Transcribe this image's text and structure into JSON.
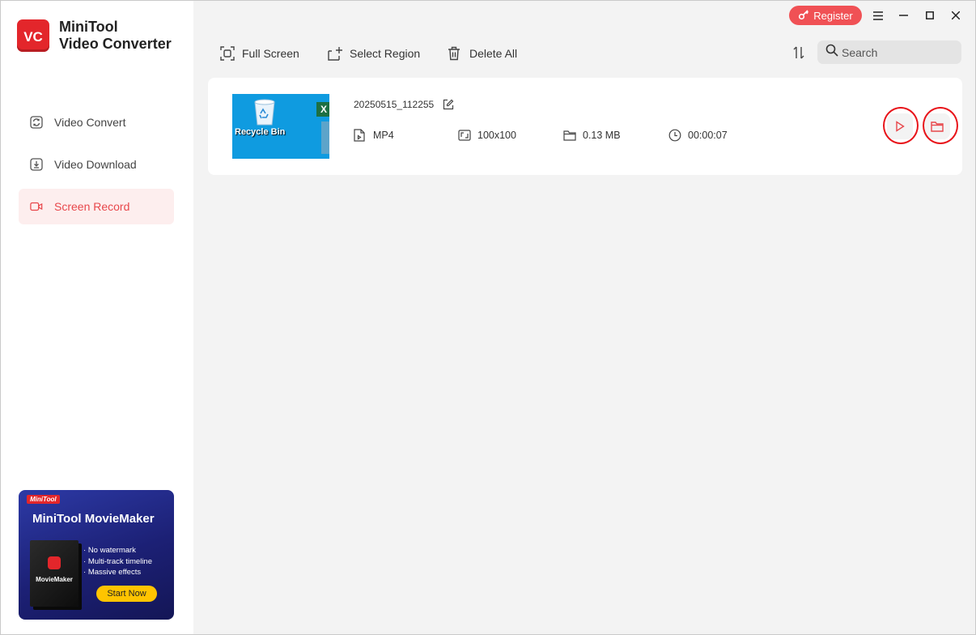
{
  "app": {
    "name_line1": "MiniTool",
    "name_line2": "Video Converter",
    "logo_text": "VC",
    "accent_color": "#e8474b"
  },
  "sidebar": {
    "items": [
      {
        "label": "Video Convert",
        "icon": "convert-icon",
        "active": false
      },
      {
        "label": "Video Download",
        "icon": "download-icon",
        "active": false
      },
      {
        "label": "Screen Record",
        "icon": "video-camera-icon",
        "active": true
      }
    ]
  },
  "promo": {
    "brand": "MiniTool",
    "title": "MiniTool MovieMaker",
    "box_label": "MovieMaker",
    "features": [
      "No watermark",
      "Multi-track timeline",
      "Massive effects"
    ],
    "cta": "Start Now"
  },
  "titlebar": {
    "register_label": "Register",
    "icons": [
      "menu-icon",
      "minimize-icon",
      "maximize-icon",
      "close-icon"
    ]
  },
  "toolbar": {
    "full_screen": "Full Screen",
    "select_region": "Select Region",
    "delete_all": "Delete All",
    "search_placeholder": "Search"
  },
  "recording": {
    "filename": "20250515_112255",
    "format": "MP4",
    "resolution": "100x100",
    "size": "0.13 MB",
    "duration": "00:00:07",
    "thumbnail_label": "Recycle Bin"
  }
}
